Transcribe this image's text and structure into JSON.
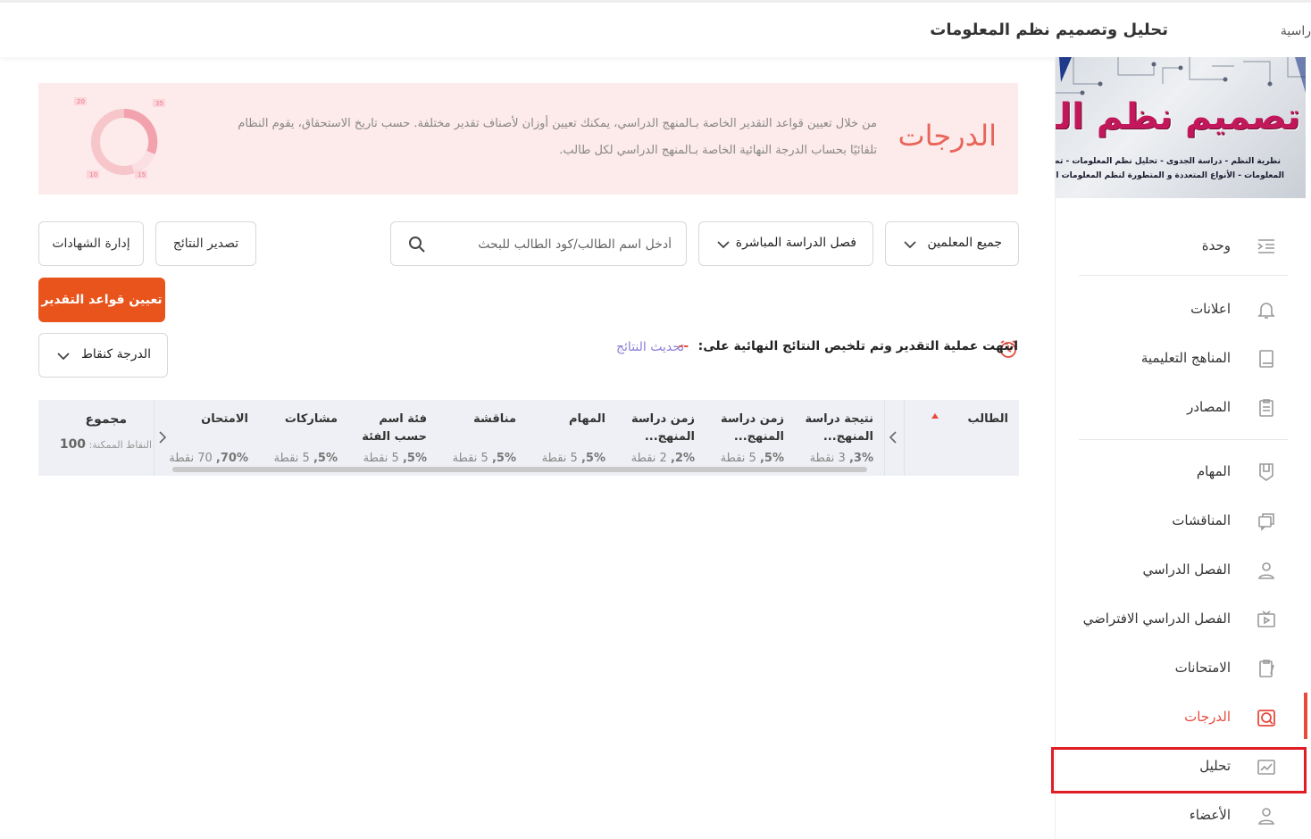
{
  "header": {
    "course_title": "تحليل وتصميم نظم المعلومات",
    "breadcrumb": "راسية"
  },
  "sidebar": {
    "cover": {
      "title": "تصميم نظم المعلومات",
      "subtitle_1": "نظرية النظم - دراسة الجدوى - تحليل نظم المعلومات - تصميم نظم",
      "subtitle_2": "المعلومات - الأنواع المتعددة و المتطورة لنظم المعلومات الأرجونومكس"
    },
    "items": [
      {
        "label": "وحدة",
        "icon": "list-indent-icon"
      },
      {
        "label": "اعلانات",
        "icon": "bell-icon"
      },
      {
        "label": "المناهج التعليمية",
        "icon": "book-icon"
      },
      {
        "label": "المصادر",
        "icon": "resource-icon"
      },
      {
        "label": "المهام",
        "icon": "task-shield-icon"
      },
      {
        "label": "المناقشات",
        "icon": "discussion-icon"
      },
      {
        "label": "الفصل الدراسي",
        "icon": "user-icon"
      },
      {
        "label": "الفصل الدراسي الافتراضي",
        "icon": "video-icon"
      },
      {
        "label": "الامتحانات",
        "icon": "clipboard-icon"
      },
      {
        "label": "الدرجات",
        "icon": "grades-icon"
      },
      {
        "label": "تحليل",
        "icon": "analytics-icon"
      },
      {
        "label": "الأعضاء",
        "icon": "members-icon"
      }
    ],
    "active_index": 9,
    "accent_color": "#e84a3c"
  },
  "banner": {
    "title": "الدرجات",
    "line_1": "من خلال تعيين قواعد التقدير الخاصة بـالمنهج الدراسي، يمكنك تعيين أوزان لأصناف تقدير مختلفة. حسب تاريخ الاستحقاق، يقوم النظام",
    "line_2": "تلقائيًا بحساب الدرجة النهائية الخاصة بـالمنهج الدراسي لكل طالب.",
    "donut_labels": [
      "20",
      "35",
      "20",
      "15",
      "10"
    ]
  },
  "filters": {
    "teachers": "جميع المعلمين",
    "live_class": "فصل الدراسة المباشرة",
    "search_placeholder": "أدخل اسم الطالب/كود الطالب للبحث",
    "export_label": "تصدير النتائج",
    "certificates_label": "إدارة الشهادات",
    "assign_rules_label": "تعيين قواعد التقدير",
    "grade_mode": "الدرجة كنقاط"
  },
  "status": {
    "text": "انتهت عملية التقدير وتم تلخيص النتائج النهائية على:",
    "value": "--",
    "refresh_label": "تحديث النتائج"
  },
  "table": {
    "student_header": "الطالب",
    "columns": [
      {
        "name_1": "نتيجة دراسة",
        "name_2": "المنهج...",
        "points": "3 نقطة",
        "percent": "3%,"
      },
      {
        "name_1": "زمن دراسة",
        "name_2": "المنهج...",
        "points": "5 نقطة",
        "percent": "5%,"
      },
      {
        "name_1": "زمن دراسة",
        "name_2": "المنهج...",
        "points": "2 نقطة",
        "percent": "2%,"
      },
      {
        "name_1": "المهام",
        "name_2": "",
        "points": "5 نقطة",
        "percent": "5%,"
      },
      {
        "name_1": "مناقشة",
        "name_2": "",
        "points": "5 نقطة",
        "percent": "5%,"
      },
      {
        "name_1": "فئة اسم",
        "name_2": "حسب الفئة",
        "points": "5 نقطة",
        "percent": "5%,"
      },
      {
        "name_1": "مشاركات",
        "name_2": "",
        "points": "5 نقطة",
        "percent": "5%,"
      },
      {
        "name_1": "الامتحان",
        "name_2": "",
        "points": "70 نقطة",
        "percent": "70%,"
      }
    ],
    "total_header": "مجموع",
    "total_sub_label": "النقاط الممكنة:",
    "total_sub_value": "100"
  }
}
